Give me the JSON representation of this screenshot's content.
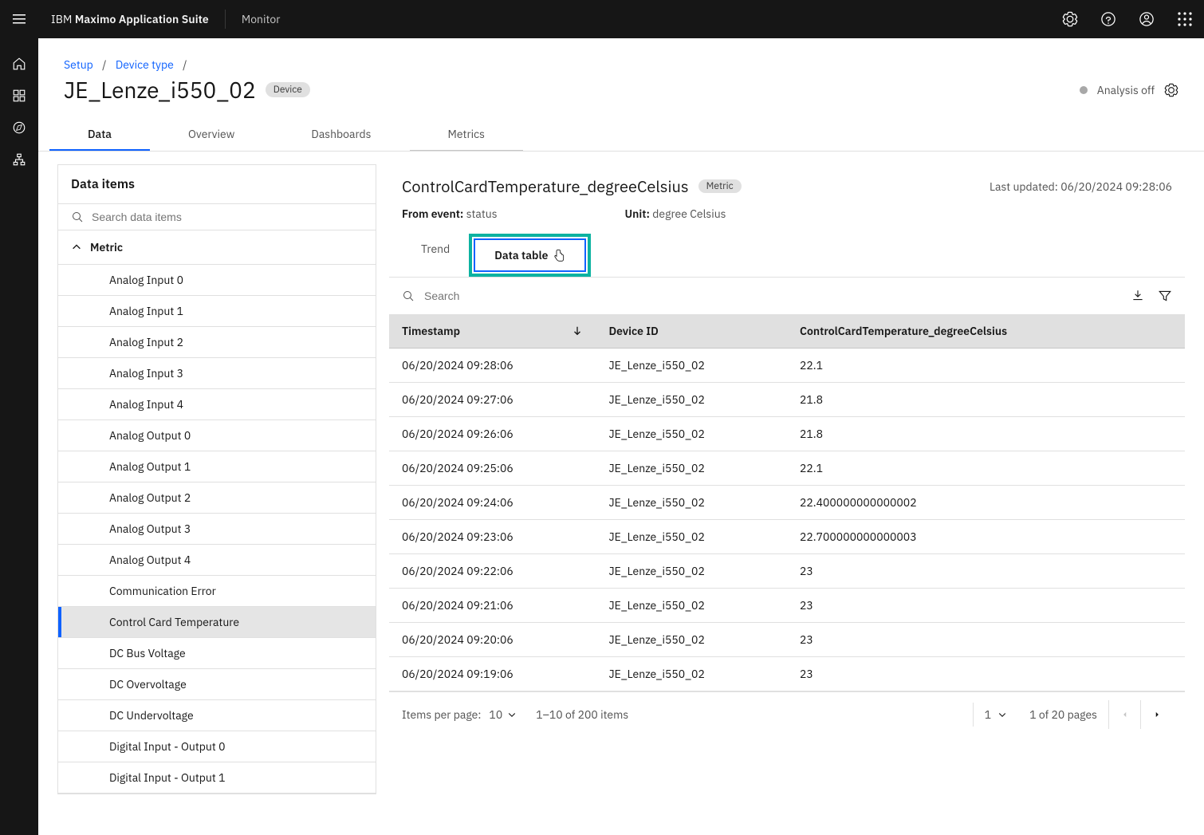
{
  "topbar": {
    "brand_prefix": "IBM ",
    "brand_bold": "Maximo Application Suite",
    "sub": "Monitor"
  },
  "breadcrumb": {
    "items": [
      {
        "label": "Setup"
      },
      {
        "label": "Device type"
      }
    ]
  },
  "header": {
    "title": "JE_Lenze_i550_02",
    "badge": "Device",
    "analysis_text": "Analysis off"
  },
  "tabs": [
    {
      "label": "Data",
      "active": true
    },
    {
      "label": "Overview"
    },
    {
      "label": "Dashboards"
    },
    {
      "label": "Metrics"
    }
  ],
  "sidebar": {
    "title": "Data items",
    "search_placeholder": "Search data items",
    "group_label": "Metric",
    "items": [
      "Analog Input 0",
      "Analog Input 1",
      "Analog Input 2",
      "Analog Input 3",
      "Analog Input 4",
      "Analog Output 0",
      "Analog Output 1",
      "Analog Output 2",
      "Analog Output 3",
      "Analog Output 4",
      "Communication Error",
      "Control Card Temperature",
      "DC Bus Voltage",
      "DC Overvoltage",
      "DC Undervoltage",
      "Digital Input - Output 0",
      "Digital Input - Output 1"
    ],
    "active_index": 11
  },
  "metric": {
    "title": "ControlCardTemperature_degreeCelsius",
    "badge": "Metric",
    "last_updated_label": "Last updated: ",
    "last_updated_value": "06/20/2024 09:28:06",
    "from_event_label": "From event:",
    "from_event_value": "status",
    "unit_label": "Unit:",
    "unit_value": "degree Celsius",
    "subtabs": {
      "trend": "Trend",
      "data_table": "Data table"
    },
    "search_placeholder": "Search"
  },
  "table": {
    "columns": [
      "Timestamp",
      "Device ID",
      "ControlCardTemperature_degreeCelsius"
    ],
    "rows": [
      {
        "ts": "06/20/2024 09:28:06",
        "id": "JE_Lenze_i550_02",
        "v": "22.1"
      },
      {
        "ts": "06/20/2024 09:27:06",
        "id": "JE_Lenze_i550_02",
        "v": "21.8"
      },
      {
        "ts": "06/20/2024 09:26:06",
        "id": "JE_Lenze_i550_02",
        "v": "21.8"
      },
      {
        "ts": "06/20/2024 09:25:06",
        "id": "JE_Lenze_i550_02",
        "v": "22.1"
      },
      {
        "ts": "06/20/2024 09:24:06",
        "id": "JE_Lenze_i550_02",
        "v": "22.400000000000002"
      },
      {
        "ts": "06/20/2024 09:23:06",
        "id": "JE_Lenze_i550_02",
        "v": "22.700000000000003"
      },
      {
        "ts": "06/20/2024 09:22:06",
        "id": "JE_Lenze_i550_02",
        "v": "23"
      },
      {
        "ts": "06/20/2024 09:21:06",
        "id": "JE_Lenze_i550_02",
        "v": "23"
      },
      {
        "ts": "06/20/2024 09:20:06",
        "id": "JE_Lenze_i550_02",
        "v": "23"
      },
      {
        "ts": "06/20/2024 09:19:06",
        "id": "JE_Lenze_i550_02",
        "v": "23"
      }
    ]
  },
  "pagination": {
    "ipp_label": "Items per page:",
    "ipp_value": "10",
    "range_text": "1–10 of 200 items",
    "page_value": "1",
    "page_of_text": "1 of 20 pages"
  }
}
